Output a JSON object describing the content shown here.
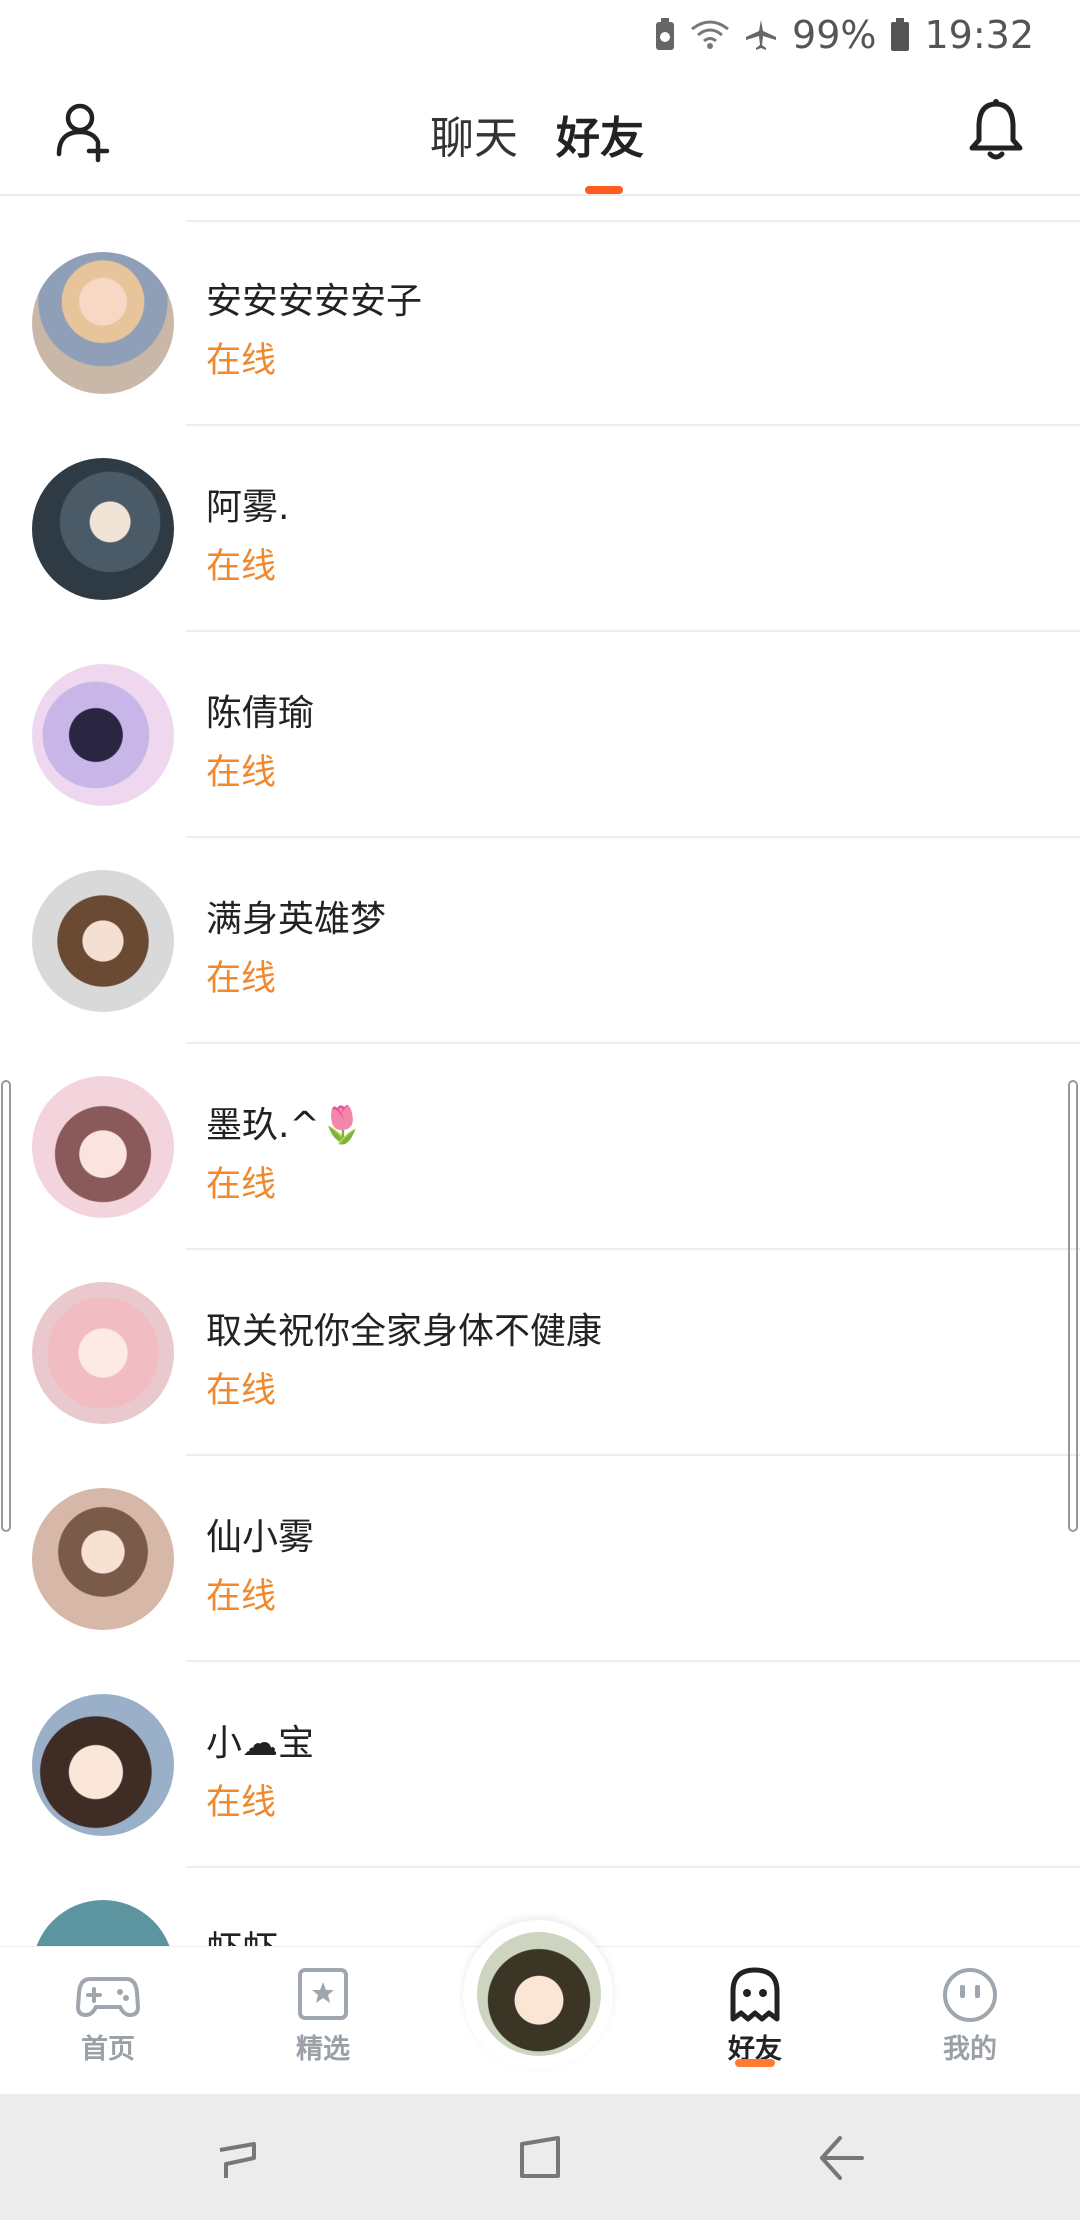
{
  "status_bar": {
    "battery": "99%",
    "time": "19:32"
  },
  "header": {
    "tabs": [
      {
        "label": "聊天"
      },
      {
        "label": "好友"
      }
    ],
    "active_tab": "好友"
  },
  "friends": [
    {
      "name": "安安安安安子",
      "status": "在线"
    },
    {
      "name": "阿雾.",
      "status": "在线"
    },
    {
      "name": "陈倩瑜",
      "status": "在线"
    },
    {
      "name": "满身英雄梦",
      "status": "在线"
    },
    {
      "name": "墨玖.^🌷",
      "status": "在线"
    },
    {
      "name": "取关祝你全家身体不健康",
      "status": "在线"
    },
    {
      "name": "仙小雾",
      "status": "在线"
    },
    {
      "name": "小☁宝",
      "status": "在线"
    },
    {
      "name": "虾虾",
      "status": ""
    }
  ],
  "bottom_nav": {
    "items": [
      {
        "label": "首页",
        "icon": "gamepad-icon"
      },
      {
        "label": "精选",
        "icon": "star-badge-icon"
      },
      {
        "label": "好友",
        "icon": "ghost-icon"
      },
      {
        "label": "我的",
        "icon": "smiley-icon"
      }
    ],
    "active": "好友"
  },
  "colors": {
    "accent": "#ff5a1f",
    "online": "#f0892e"
  }
}
